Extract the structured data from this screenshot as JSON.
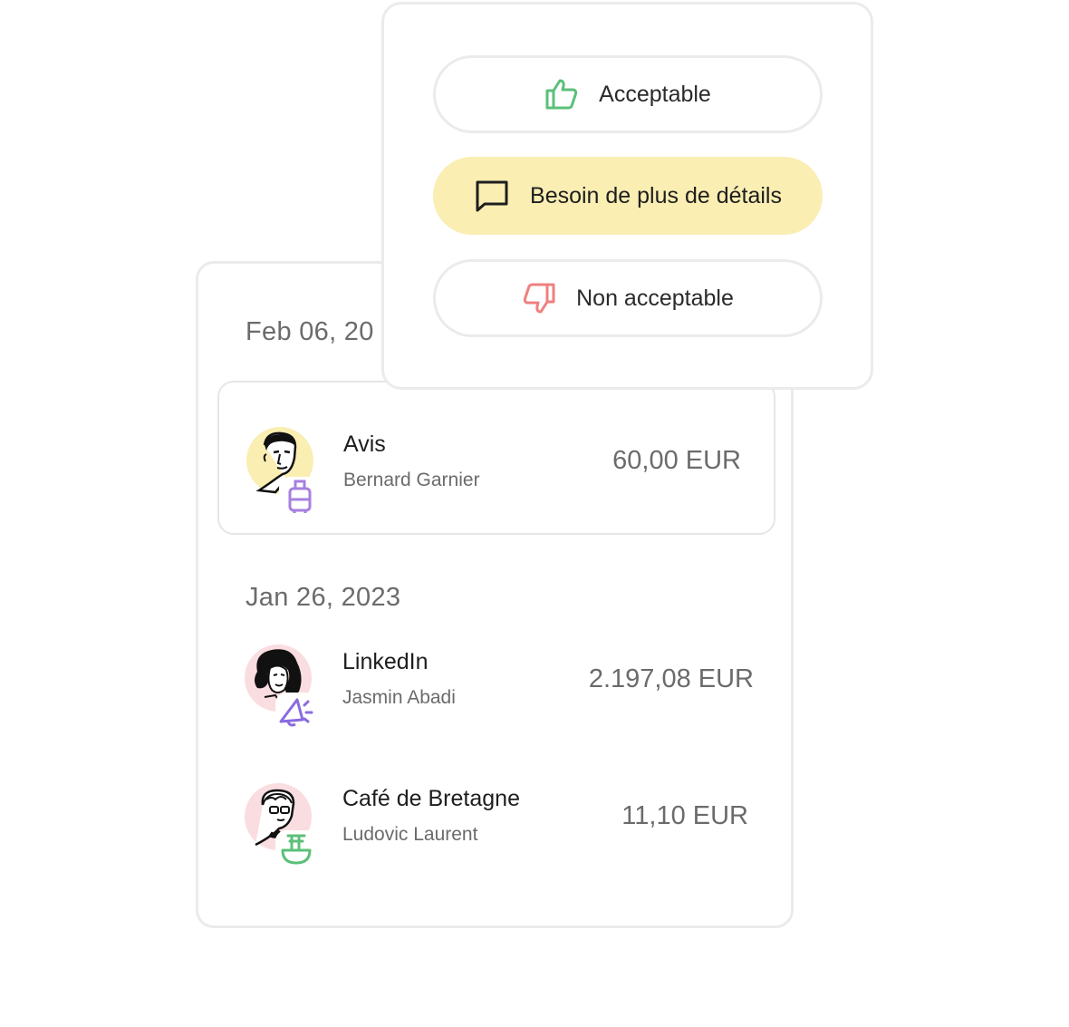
{
  "colors": {
    "accent_yellow": "#faeeb3",
    "positive_green": "#5cc07a",
    "negative_red": "#ef8080",
    "category_purple": "#a77fe0",
    "avatar_yellow": "#faeeb3",
    "avatar_pink": "#fadde0"
  },
  "popover": {
    "options": [
      {
        "label": "Acceptable",
        "icon": "thumbs-up-icon",
        "selected": false
      },
      {
        "label": "Besoin de plus de détails",
        "icon": "message-bubble-icon",
        "selected": true
      },
      {
        "label": "Non acceptable",
        "icon": "thumbs-down-icon",
        "selected": false
      }
    ]
  },
  "transactions": {
    "groups": [
      {
        "date": "Feb 06, 20",
        "items": [
          {
            "merchant": "Avis",
            "person": "Bernard Garnier",
            "amount": "60,00 EUR",
            "category_icon": "luggage-icon",
            "selected": true
          }
        ]
      },
      {
        "date": "Jan 26, 2023",
        "items": [
          {
            "merchant": "LinkedIn",
            "person": "Jasmin Abadi",
            "amount": "2.197,08 EUR",
            "category_icon": "megaphone-icon",
            "selected": false
          },
          {
            "merchant": "Café de Bretagne",
            "person": "Ludovic Laurent",
            "amount": "11,10 EUR",
            "category_icon": "food-bowl-icon",
            "selected": false
          }
        ]
      }
    ]
  }
}
